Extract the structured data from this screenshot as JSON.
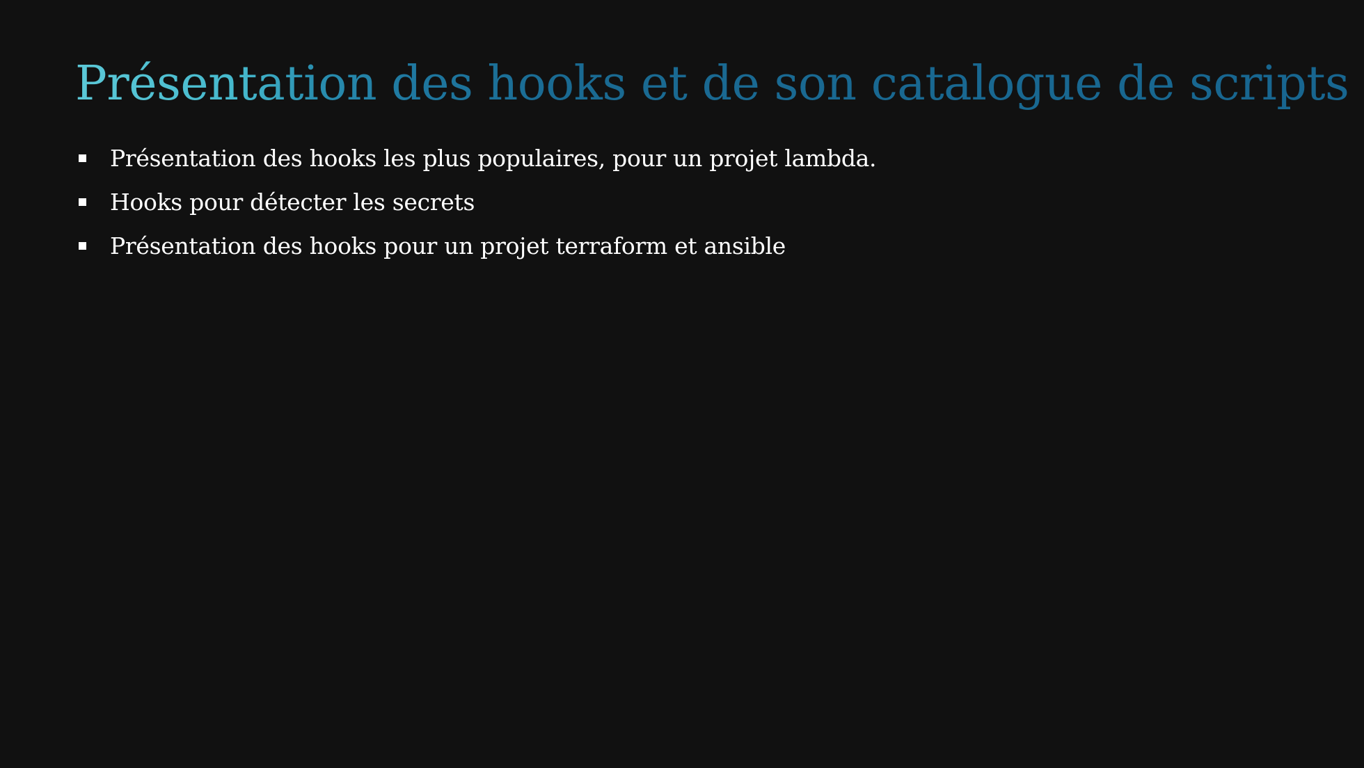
{
  "slide": {
    "title": "Présentation des hooks et de son catalogue de scripts",
    "bullets": [
      "Présentation des hooks les plus populaires, pour un projet lambda.",
      "Hooks pour détecter les secrets",
      "Présentation des hooks pour un projet terraform et ansible"
    ]
  },
  "colors": {
    "background": "#111111",
    "title_start": "#5cc9d8",
    "title_end": "#186690",
    "text": "#ffffff"
  }
}
